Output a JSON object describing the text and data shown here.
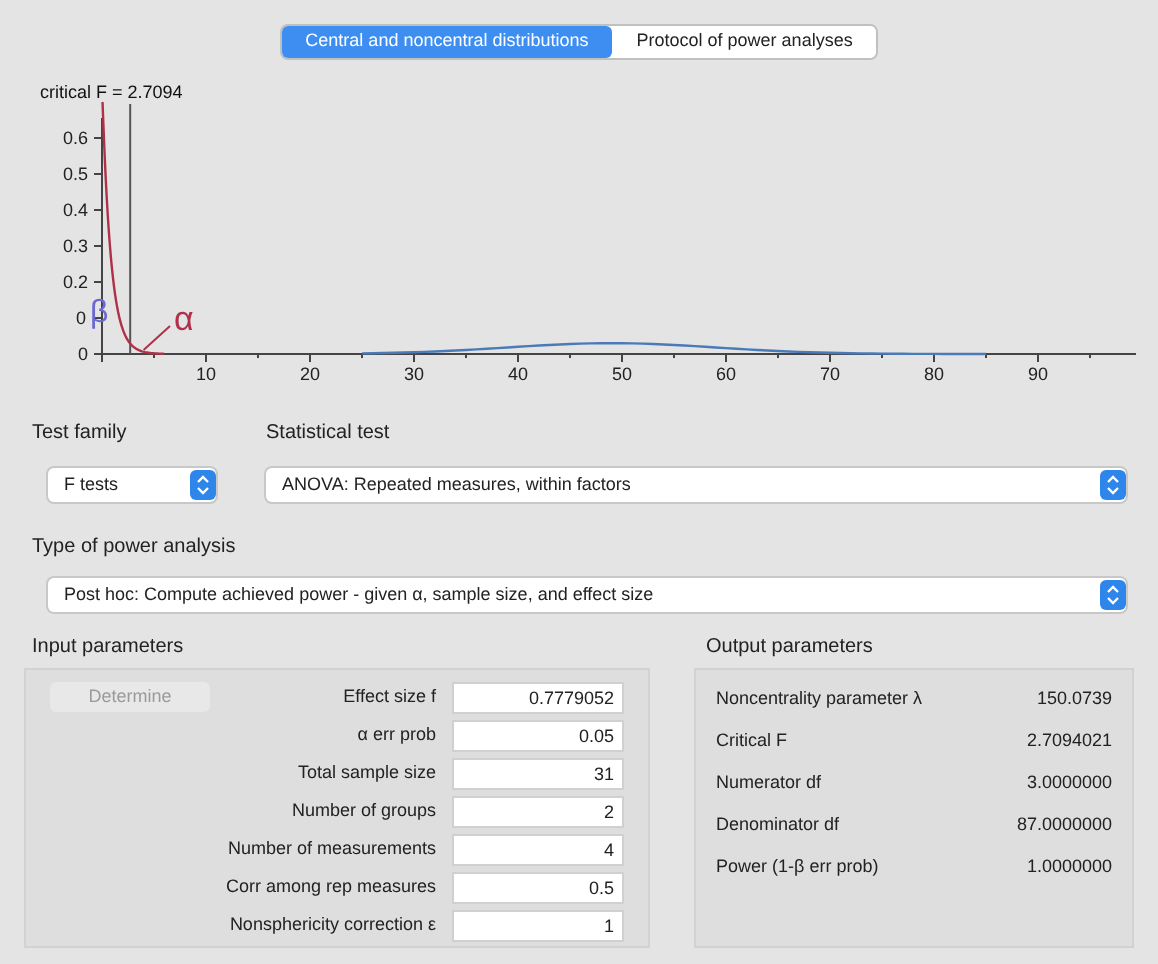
{
  "tabs": [
    {
      "label": "Central and noncentral distributions",
      "selected": true
    },
    {
      "label": "Protocol of power analyses",
      "selected": false
    }
  ],
  "plot": {
    "caption": "critical F = 2.7094",
    "y_ticks": [
      "0.6",
      "0.5",
      "0.4",
      "0.3",
      "0.2",
      "0",
      "0"
    ],
    "x_ticks": [
      "10",
      "20",
      "30",
      "40",
      "50",
      "60",
      "70",
      "80",
      "90"
    ],
    "beta": "β",
    "alpha": "α"
  },
  "test_family": {
    "label": "Test family",
    "value": "F tests"
  },
  "statistical_test": {
    "label": "Statistical test",
    "value": "ANOVA: Repeated measures, within factors"
  },
  "analysis_type": {
    "label": "Type of power analysis",
    "value": "Post hoc: Compute achieved power - given α, sample size, and effect size"
  },
  "input_parameters": {
    "title": "Input parameters",
    "determine_button": {
      "label": "Determine",
      "disabled": true
    },
    "rows": [
      {
        "label": "Effect size f",
        "value": "0.7779052"
      },
      {
        "label": "α err prob",
        "value": "0.05"
      },
      {
        "label": "Total sample size",
        "value": "31"
      },
      {
        "label": "Number of groups",
        "value": "2"
      },
      {
        "label": "Number of measurements",
        "value": "4"
      },
      {
        "label": "Corr among rep measures",
        "value": "0.5"
      },
      {
        "label": "Nonsphericity correction ε",
        "value": "1"
      }
    ]
  },
  "output_parameters": {
    "title": "Output parameters",
    "rows": [
      {
        "label": "Noncentrality parameter λ",
        "value": "150.0739"
      },
      {
        "label": "Critical F",
        "value": "2.7094021"
      },
      {
        "label": "Numerator df",
        "value": "3.0000000"
      },
      {
        "label": "Denominator df",
        "value": "87.0000000"
      },
      {
        "label": "Power (1-β err prob)",
        "value": "1.0000000"
      }
    ]
  }
}
